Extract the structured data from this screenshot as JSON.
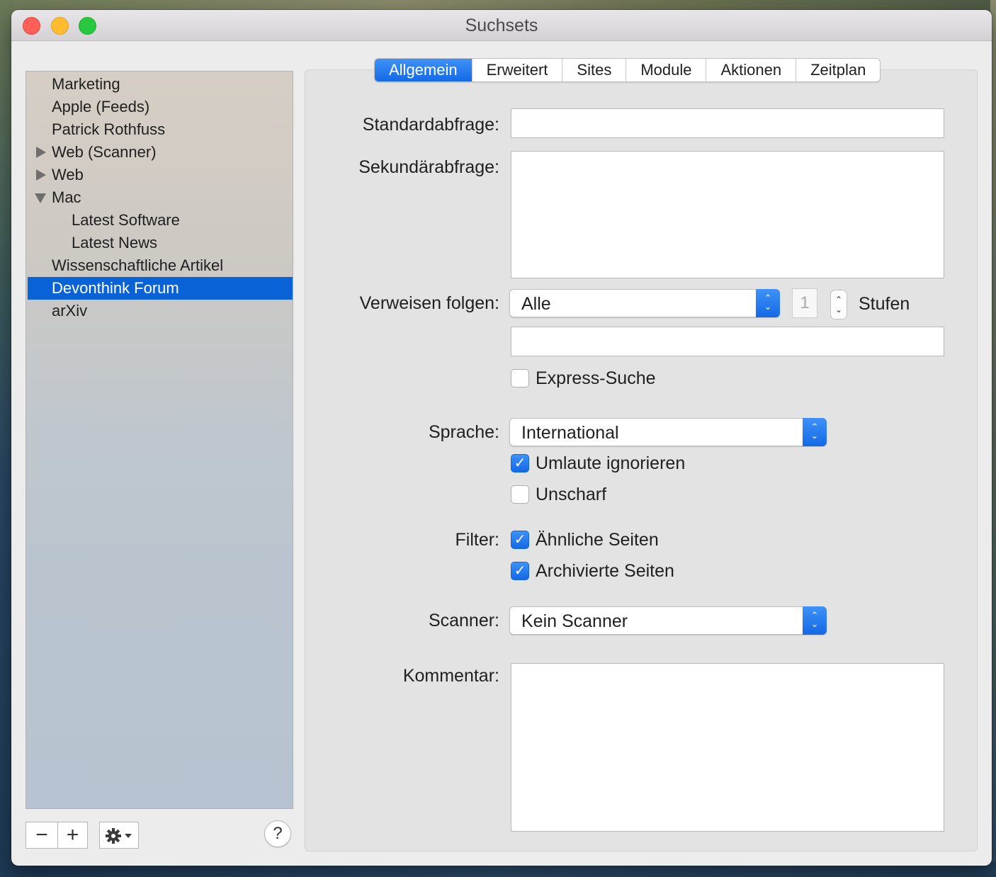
{
  "window": {
    "title": "Suchsets"
  },
  "sidebar": {
    "items": [
      {
        "label": "Marketing",
        "level": 0,
        "disclosure": "none",
        "selected": false
      },
      {
        "label": "Apple (Feeds)",
        "level": 0,
        "disclosure": "none",
        "selected": false
      },
      {
        "label": "Patrick Rothfuss",
        "level": 0,
        "disclosure": "none",
        "selected": false
      },
      {
        "label": "Web (Scanner)",
        "level": 0,
        "disclosure": "closed",
        "selected": false
      },
      {
        "label": "Web",
        "level": 0,
        "disclosure": "closed",
        "selected": false
      },
      {
        "label": "Mac",
        "level": 0,
        "disclosure": "open",
        "selected": false
      },
      {
        "label": "Latest Software",
        "level": 1,
        "disclosure": "none",
        "selected": false
      },
      {
        "label": "Latest News",
        "level": 1,
        "disclosure": "none",
        "selected": false
      },
      {
        "label": "Wissenschaftliche Artikel",
        "level": 0,
        "disclosure": "none",
        "selected": false
      },
      {
        "label": "Devonthink Forum",
        "level": 0,
        "disclosure": "none",
        "selected": true
      },
      {
        "label": "arXiv",
        "level": 0,
        "disclosure": "none",
        "selected": false
      }
    ],
    "buttons": {
      "remove": "−",
      "add": "+",
      "action_icon": "gear-icon",
      "help": "?"
    }
  },
  "tabs": [
    {
      "label": "Allgemein",
      "active": true
    },
    {
      "label": "Erweitert",
      "active": false
    },
    {
      "label": "Sites",
      "active": false
    },
    {
      "label": "Module",
      "active": false
    },
    {
      "label": "Aktionen",
      "active": false
    },
    {
      "label": "Zeitplan",
      "active": false
    }
  ],
  "form": {
    "standard_label": "Standardabfrage:",
    "standard_value": "",
    "secondary_label": "Sekundärabfrage:",
    "secondary_value": "",
    "follow_label": "Verweisen folgen:",
    "follow_value": "Alle",
    "levels_value": "1",
    "levels_unit": "Stufen",
    "follow_extra_value": "",
    "express_label": "Express-Suche",
    "express_checked": false,
    "language_label": "Sprache:",
    "language_value": "International",
    "umlaut_label": "Umlaute ignorieren",
    "umlaut_checked": true,
    "fuzzy_label": "Unscharf",
    "fuzzy_checked": false,
    "filter_label": "Filter:",
    "similar_label": "Ähnliche Seiten",
    "similar_checked": true,
    "archived_label": "Archivierte Seiten",
    "archived_checked": true,
    "scanner_label": "Scanner:",
    "scanner_value": "Kein Scanner",
    "comment_label": "Kommentar:",
    "comment_value": ""
  },
  "colors": {
    "accent": "#1469e6",
    "selection": "#0a63d6"
  }
}
